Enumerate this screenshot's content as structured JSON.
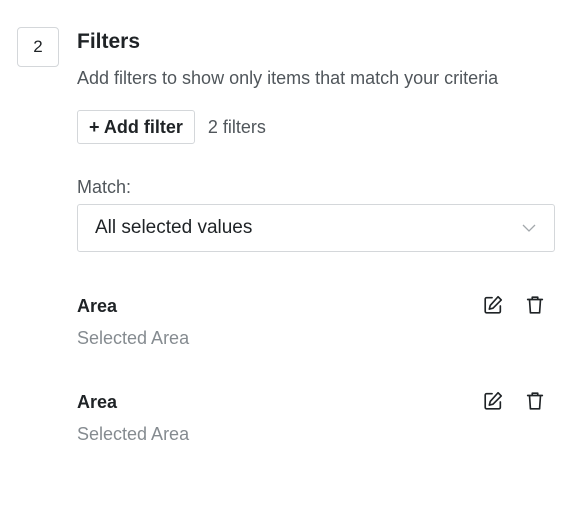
{
  "step": {
    "number": "2"
  },
  "section": {
    "title": "Filters",
    "description": "Add filters to show only items that match your criteria"
  },
  "toolbar": {
    "add_filter_label": "+ Add filter",
    "filter_count": "2 filters"
  },
  "match": {
    "label": "Match:",
    "selected": "All selected values"
  },
  "filters": [
    {
      "name": "Area",
      "value": "Selected Area",
      "edit_icon": "edit-icon",
      "delete_icon": "trash-icon"
    },
    {
      "name": "Area",
      "value": "Selected Area",
      "edit_icon": "edit-icon",
      "delete_icon": "trash-icon"
    }
  ],
  "colors": {
    "text": "#1f2326",
    "muted": "#858b90",
    "border": "#d4d7da"
  }
}
